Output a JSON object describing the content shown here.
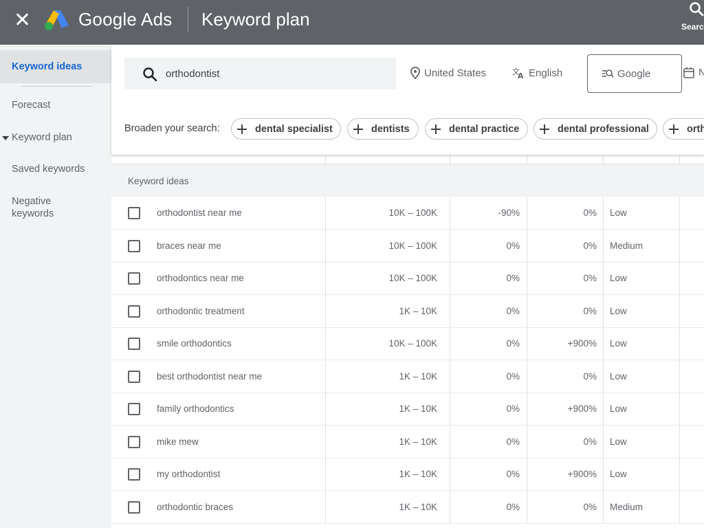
{
  "header": {
    "brand": "Google Ads",
    "page_title": "Keyword plan",
    "search_label": "Search"
  },
  "sidebar": {
    "items": [
      {
        "label": "Keyword ideas",
        "active": true
      },
      {
        "label": "Forecast"
      },
      {
        "label": "Keyword plan"
      },
      {
        "label": "Saved keywords"
      },
      {
        "label": "Negative keywords"
      }
    ]
  },
  "filters": {
    "search_value": "orthodontist",
    "location": "United States",
    "language": "English",
    "network": "Google",
    "date_partial": "N",
    "broaden_label": "Broaden your search:",
    "chips": [
      "dental specialist",
      "dentists",
      "dental practice",
      "dental professional",
      "orth"
    ]
  },
  "table": {
    "group_label": "Keyword ideas",
    "rows": [
      {
        "keyword": "orthodontist near me",
        "volume": "10K – 100K",
        "three_month": "-90%",
        "yoy": "0%",
        "competition": "Low"
      },
      {
        "keyword": "braces near me",
        "volume": "10K – 100K",
        "three_month": "0%",
        "yoy": "0%",
        "competition": "Medium"
      },
      {
        "keyword": "orthodontics near me",
        "volume": "10K – 100K",
        "three_month": "0%",
        "yoy": "0%",
        "competition": "Low"
      },
      {
        "keyword": "orthodontic treatment",
        "volume": "1K – 10K",
        "three_month": "0%",
        "yoy": "0%",
        "competition": "Low"
      },
      {
        "keyword": "smile orthodontics",
        "volume": "10K – 100K",
        "three_month": "0%",
        "yoy": "+900%",
        "competition": "Low"
      },
      {
        "keyword": "best orthodontist near me",
        "volume": "1K – 10K",
        "three_month": "0%",
        "yoy": "0%",
        "competition": "Low"
      },
      {
        "keyword": "family orthodontics",
        "volume": "1K – 10K",
        "three_month": "0%",
        "yoy": "+900%",
        "competition": "Low"
      },
      {
        "keyword": "mike mew",
        "volume": "1K – 10K",
        "three_month": "0%",
        "yoy": "0%",
        "competition": "Low"
      },
      {
        "keyword": "my orthodontist",
        "volume": "1K – 10K",
        "three_month": "0%",
        "yoy": "+900%",
        "competition": "Low"
      },
      {
        "keyword": "orthodontic braces",
        "volume": "1K – 10K",
        "three_month": "0%",
        "yoy": "0%",
        "competition": "Medium"
      }
    ]
  },
  "colors": {
    "topbar": "#5f6368",
    "sidebar": "#f1f3f4",
    "active_text": "#1967d2",
    "logo_blue": "#4285f4",
    "logo_yellow": "#fbbc04",
    "logo_green": "#34a853"
  }
}
